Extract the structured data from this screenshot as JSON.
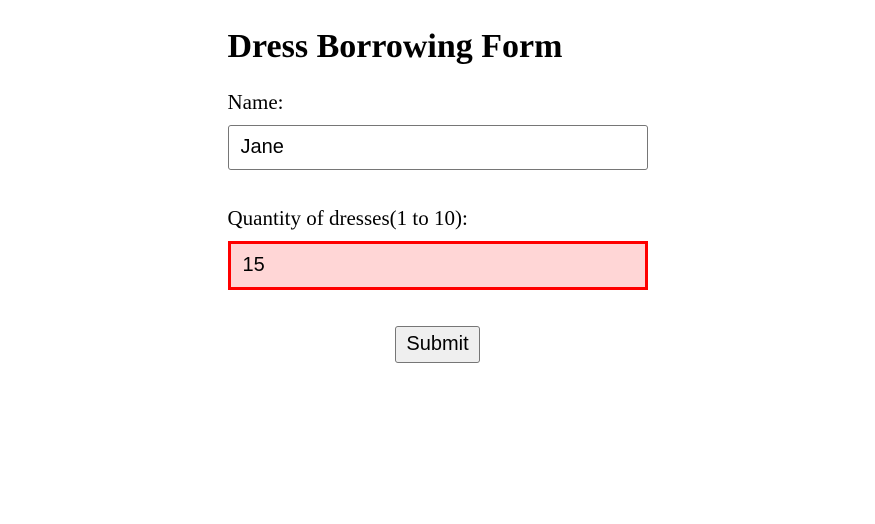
{
  "title": "Dress Borrowing Form",
  "fields": {
    "name": {
      "label": "Name:",
      "value": "Jane"
    },
    "quantity": {
      "label": "Quantity of dresses(1 to 10):",
      "value": "15",
      "min": 1,
      "max": 10,
      "invalid": true
    }
  },
  "submit_label": "Submit"
}
